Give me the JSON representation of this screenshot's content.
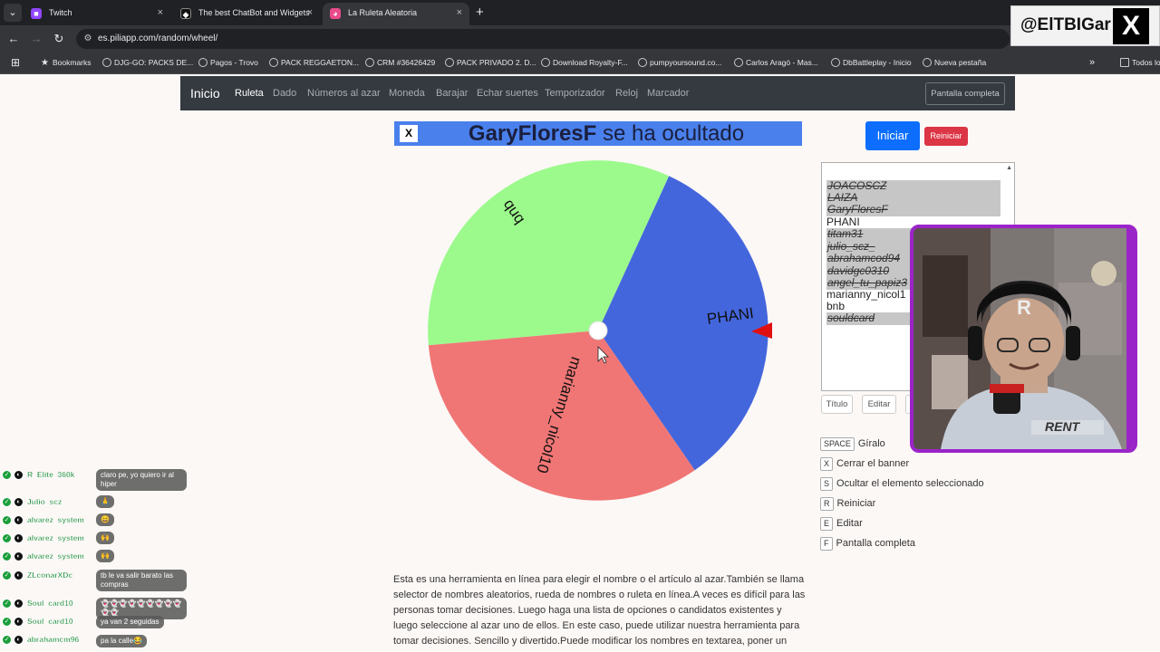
{
  "browser": {
    "tabs": [
      {
        "title": "Twitch",
        "favicon_color": "#9146ff",
        "favicon": "■",
        "active": false
      },
      {
        "title": "The best ChatBot and Widgets",
        "favicon_color": "#202124",
        "favicon": "◆",
        "active": false
      },
      {
        "title": "La Ruleta Aleatoria",
        "favicon_color": "#e94b8a",
        "favicon": "◕",
        "active": true
      }
    ],
    "tab_close": "×",
    "tab_menu": "⌄",
    "new_tab": "+",
    "url": "es.piliapp.com/random/wheel/",
    "bookmarks": [
      "Bookmarks",
      "DJG-GO: PACKS DE...",
      "Pagos - Trovo",
      "PACK REGGAETON...",
      "CRM #36426429",
      "PACK PRIVADO 2. D...",
      "Download Royalty-F...",
      "pumpyoursound.co...",
      "Carlos Aragó - Mas...",
      "DbBattleplay - Inicio",
      "Nueva pestaña",
      "Todos los"
    ],
    "bookmarks_more": "»"
  },
  "overlay": {
    "handle": "@ElTBIGar",
    "x_logo": "X"
  },
  "site_nav": {
    "brand": "Inicio",
    "links": [
      "Ruleta",
      "Dado",
      "Números al azar",
      "Moneda",
      "Barajar",
      "Echar suertes",
      "Temporizador",
      "Reloj",
      "Marcador"
    ],
    "fullscreen": "Pantalla completa"
  },
  "banner": {
    "close": "X",
    "name": "GaryFloresF",
    "text": "se ha ocultado"
  },
  "wheel": {
    "segments": [
      {
        "label": "bnb",
        "color": "#9cfa8c"
      },
      {
        "label": "PHANI",
        "color": "#4466dd"
      },
      {
        "label": "marianny_nicol10",
        "color": "#f07675"
      }
    ],
    "pointer_color": "#e01010"
  },
  "controls": {
    "start": "Iniciar",
    "reset": "Reiniciar"
  },
  "names": [
    {
      "text": "JOACOSCZ",
      "hidden": true
    },
    {
      "text": "LAIZA",
      "hidden": true
    },
    {
      "text": "GaryFloresF",
      "hidden": true
    },
    {
      "text": "PHANI",
      "hidden": false
    },
    {
      "text": "titam31",
      "hidden": true
    },
    {
      "text": "julio_scz_",
      "hidden": true
    },
    {
      "text": "abrahamcod94",
      "hidden": true
    },
    {
      "text": "davidgc0310",
      "hidden": true
    },
    {
      "text": "angel_tu_papiz3",
      "hidden": true
    },
    {
      "text": "marianny_nicol1",
      "hidden": false
    },
    {
      "text": "bnb",
      "hidden": false
    },
    {
      "text": "souldcard",
      "hidden": true
    }
  ],
  "small_buttons": [
    "Título",
    "Editar"
  ],
  "shortcuts": [
    {
      "key": "SPACE",
      "desc": "Gíralo"
    },
    {
      "key": "X",
      "desc": "Cerrar el banner"
    },
    {
      "key": "S",
      "desc": "Ocultar el elemento seleccionado"
    },
    {
      "key": "R",
      "desc": "Reiniciar"
    },
    {
      "key": "E",
      "desc": "Editar"
    },
    {
      "key": "F",
      "desc": "Pantalla completa"
    }
  ],
  "description": "Esta es una herramienta en línea para elegir el nombre o el artículo al azar.También se llama selector de nombres aleatorios, rueda de nombres o ruleta en línea.A veces es difícil para las personas tomar decisiones. Luego haga una lista de opciones o candidatos existentes y luego seleccione al azar uno de ellos. En este caso, puede utilizar nuestra herramienta para tomar decisiones. Sencillo y divertido.Puede modificar los nombres en textarea, poner un",
  "webcam": {
    "cap_text": "RENT"
  },
  "chat": [
    {
      "user": "R_Elite_360k",
      "msg": "claro pe, yo quiero ir al hiper"
    },
    {
      "user": "Julio_scz",
      "msg": "🙏"
    },
    {
      "user": "alvarez_system",
      "msg": "😄"
    },
    {
      "user": "alvarez_system",
      "msg": "🙌"
    },
    {
      "user": "alvarez_system",
      "msg": "🙌"
    },
    {
      "user": "ZLconarXDc",
      "msg": "tb le va salir barato las compras"
    },
    {
      "user": "Soul_card10",
      "msg": "👻👻👻👻👻👻👻👻👻👻👻"
    },
    {
      "user": "Soul_card10",
      "msg": "ya van 2 seguidas"
    },
    {
      "user": "abrahamcm96",
      "msg": "pa la calle😂"
    }
  ]
}
